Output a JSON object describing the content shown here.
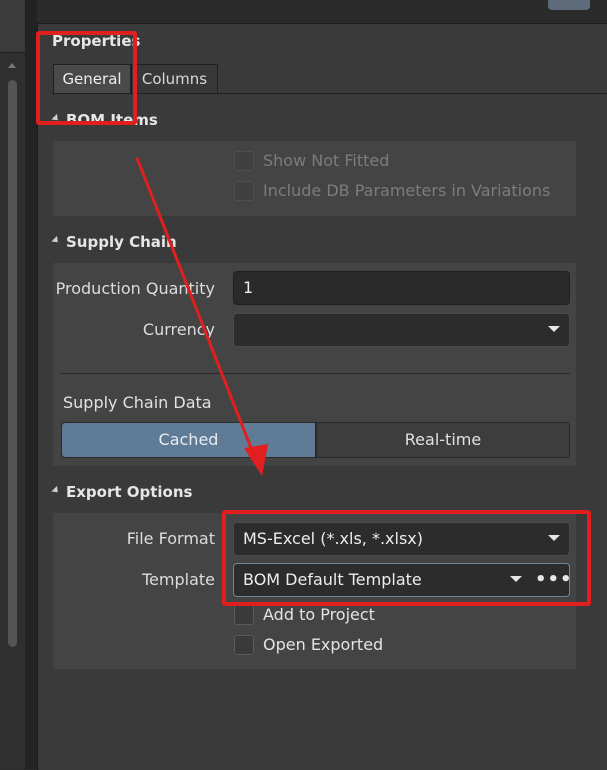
{
  "panel": {
    "title": "Properties"
  },
  "tabs": [
    {
      "label": "General",
      "active": true
    },
    {
      "label": "Columns",
      "active": false
    }
  ],
  "bom_items": {
    "header": "BOM Items",
    "show_not_fitted": {
      "label": "Show Not Fitted",
      "checked": false,
      "enabled": false
    },
    "include_db_params": {
      "label": "Include DB Parameters in Variations",
      "checked": false,
      "enabled": false
    }
  },
  "supply_chain": {
    "header": "Supply Chain",
    "production_quantity_label": "Production Quantity",
    "production_quantity_value": "1",
    "currency_label": "Currency",
    "currency_value": "",
    "data_label": "Supply Chain Data",
    "data_options": [
      "Cached",
      "Real-time"
    ],
    "data_selected": "Cached"
  },
  "export_options": {
    "header": "Export Options",
    "file_format_label": "File Format",
    "file_format_value": "MS-Excel (*.xls, *.xlsx)",
    "template_label": "Template",
    "template_value": "BOM Default Template",
    "template_more": "•••",
    "add_to_project": {
      "label": "Add to Project",
      "checked": false
    },
    "open_exported": {
      "label": "Open Exported",
      "checked": false
    }
  },
  "colors": {
    "annotation": "#e21f1f",
    "selected_segment": "#5f7b96",
    "panel_bg": "#3a3a3a"
  },
  "icons": [
    "collapse-triangle-icon",
    "dropdown-caret-icon",
    "more-options-icon",
    "scroll-up-arrow-icon"
  ]
}
